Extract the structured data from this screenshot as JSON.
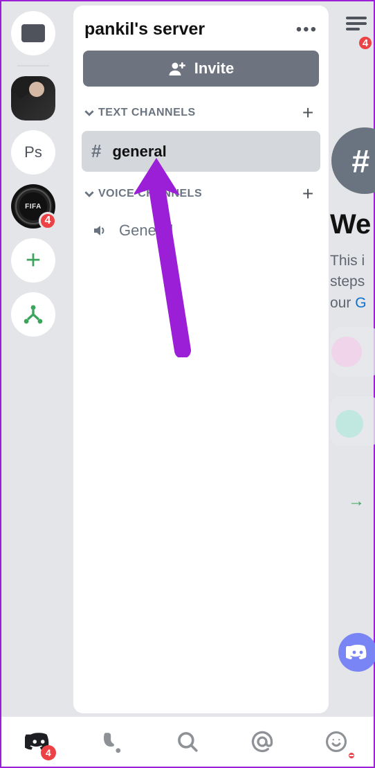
{
  "guild_rail": {
    "ps_label": "Ps",
    "crest_label": "FIFA",
    "crest_badge": "4"
  },
  "panel": {
    "title": "pankil's server",
    "invite_label": "Invite",
    "categories": {
      "text": {
        "name": "TEXT CHANNELS",
        "channels": [
          {
            "name": "general"
          }
        ]
      },
      "voice": {
        "name": "VOICE CHANNELS",
        "channels": [
          {
            "name": "General"
          }
        ]
      }
    }
  },
  "right_peek": {
    "badge": "4",
    "welcome": "We",
    "line1": "This i",
    "line2": "steps",
    "line3_prefix": "our ",
    "line3_link": "G"
  },
  "nav": {
    "badge": "4"
  }
}
